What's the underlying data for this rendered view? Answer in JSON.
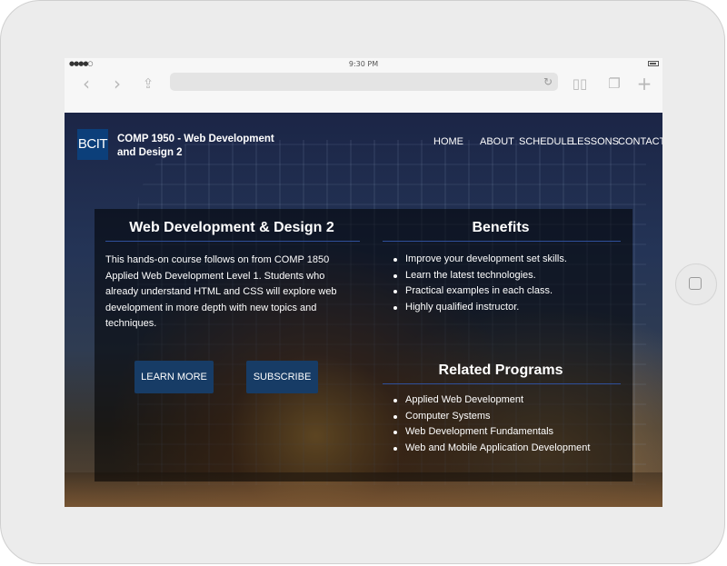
{
  "status_bar": {
    "time": "9:30 PM"
  },
  "toolbar": {
    "back_icon": "chevron-left-icon",
    "forward_icon": "chevron-right-icon",
    "share_icon": "share-icon",
    "reload_icon": "reload-icon",
    "bookmarks_icon": "book-icon",
    "tabs_icon": "tabs-icon",
    "new_tab_icon": "plus-icon",
    "url_value": ""
  },
  "header": {
    "logo": "BCIT",
    "course_title": "COMP 1950 - Web Development and Design 2",
    "nav": [
      "HOME",
      "ABOUT",
      "SCHEDULE",
      "LESSONS",
      "CONTACT"
    ]
  },
  "intro": {
    "heading": "Web Development & Design 2",
    "text": "This hands-on course follows on from COMP 1850 Applied Web Development Level 1. Students who already understand HTML and CSS will explore web development in more depth with new topics and techniques.",
    "learn_more": "LEARN MORE",
    "subscribe": "SUBSCRIBE"
  },
  "benefits": {
    "heading": "Benefits",
    "items": [
      "Improve your development set skills.",
      "Learn the latest technologies.",
      "Practical examples in each class.",
      "Highly qualified instructor."
    ]
  },
  "related": {
    "heading": "Related Programs",
    "items": [
      "Applied Web Development",
      "Computer Systems",
      "Web Development Fundamentals",
      "Web and Mobile Application Development"
    ]
  },
  "colors": {
    "primary": "#173c66",
    "logo_bg": "#0c3f7a",
    "divider": "#2f4f9a"
  }
}
